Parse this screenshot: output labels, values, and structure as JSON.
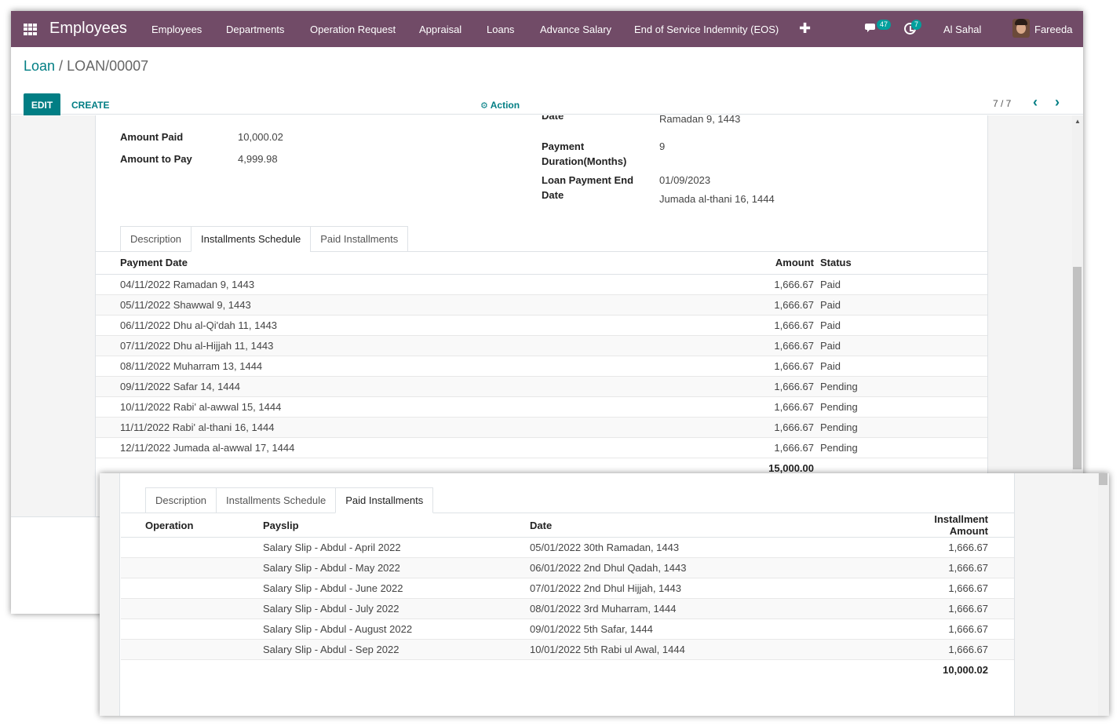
{
  "navbar": {
    "app_title": "Employees",
    "menu": [
      "Employees",
      "Departments",
      "Operation Request",
      "Appraisal",
      "Loans",
      "Advance Salary",
      "End of Service Indemnity (EOS)"
    ],
    "messages_count": "47",
    "activities_count": "7",
    "company": "Al Sahal",
    "user": "Fareeda"
  },
  "breadcrumb": {
    "parent": "Loan",
    "separator": " / ",
    "current": "LOAN/00007"
  },
  "toolbar": {
    "edit_label": "EDIT",
    "create_label": "CREATE",
    "action_label": "Action",
    "pager": "7 / 7"
  },
  "form": {
    "amount_paid_label": "Amount Paid",
    "amount_paid": "10,000.02",
    "amount_to_pay_label": "Amount to Pay",
    "amount_to_pay": "4,999.98",
    "start_date_partial_label": "Date",
    "start_date_hijri": "Ramadan 9, 1443",
    "payment_duration_label_1": "Payment",
    "payment_duration_label_2": "Duration(Months)",
    "payment_duration": "9",
    "end_date_label_1": "Loan Payment End",
    "end_date_label_2": "Date",
    "end_date": "01/09/2023",
    "end_date_hijri": "Jumada al-thani 16, 1444"
  },
  "tabs": [
    "Description",
    "Installments Schedule",
    "Paid Installments"
  ],
  "schedule": {
    "headers": {
      "date": "Payment Date",
      "amount": "Amount",
      "status": "Status"
    },
    "rows": [
      {
        "date": "04/11/2022 Ramadan 9, 1443",
        "amount": "1,666.67",
        "status": "Paid"
      },
      {
        "date": "05/11/2022 Shawwal 9, 1443",
        "amount": "1,666.67",
        "status": "Paid"
      },
      {
        "date": "06/11/2022 Dhu al-Qi'dah 11, 1443",
        "amount": "1,666.67",
        "status": "Paid"
      },
      {
        "date": "07/11/2022 Dhu al-Hijjah 11, 1443",
        "amount": "1,666.67",
        "status": "Paid"
      },
      {
        "date": "08/11/2022 Muharram 13, 1444",
        "amount": "1,666.67",
        "status": "Paid"
      },
      {
        "date": "09/11/2022 Safar 14, 1444",
        "amount": "1,666.67",
        "status": "Pending"
      },
      {
        "date": "10/11/2022 Rabi' al-awwal 15, 1444",
        "amount": "1,666.67",
        "status": "Pending"
      },
      {
        "date": "11/11/2022 Rabi' al-thani 16, 1444",
        "amount": "1,666.67",
        "status": "Pending"
      },
      {
        "date": "12/11/2022 Jumada al-awwal 17, 1444",
        "amount": "1,666.67",
        "status": "Pending"
      }
    ],
    "total": "15,000.00"
  },
  "paid": {
    "headers": {
      "operation": "Operation",
      "payslip": "Payslip",
      "date": "Date",
      "amount": "Installment Amount"
    },
    "rows": [
      {
        "payslip": "Salary Slip - Abdul - April 2022",
        "date": "05/01/2022 30th Ramadan, 1443",
        "amount": "1,666.67"
      },
      {
        "payslip": "Salary Slip - Abdul - May 2022",
        "date": "06/01/2022 2nd Dhul Qadah, 1443",
        "amount": "1,666.67"
      },
      {
        "payslip": "Salary Slip - Abdul - June 2022",
        "date": "07/01/2022 2nd Dhul Hijjah, 1443",
        "amount": "1,666.67"
      },
      {
        "payslip": "Salary Slip - Abdul - July 2022",
        "date": "08/01/2022 3rd Muharram, 1444",
        "amount": "1,666.67"
      },
      {
        "payslip": "Salary Slip - Abdul - August 2022",
        "date": "09/01/2022 5th Safar, 1444",
        "amount": "1,666.67"
      },
      {
        "payslip": "Salary Slip - Abdul - Sep 2022",
        "date": "10/01/2022 5th Rabi ul Awal, 1444",
        "amount": "1,666.67"
      }
    ],
    "total": "10,000.02"
  },
  "colors": {
    "navbar": "#714b67",
    "accent": "#017e84",
    "badge": "#00a09d"
  },
  "icons": [
    "apps-grid-icon",
    "plus-icon",
    "chat-icon",
    "clock-icon",
    "gear-icon",
    "chevron-left-icon",
    "chevron-right-icon"
  ]
}
